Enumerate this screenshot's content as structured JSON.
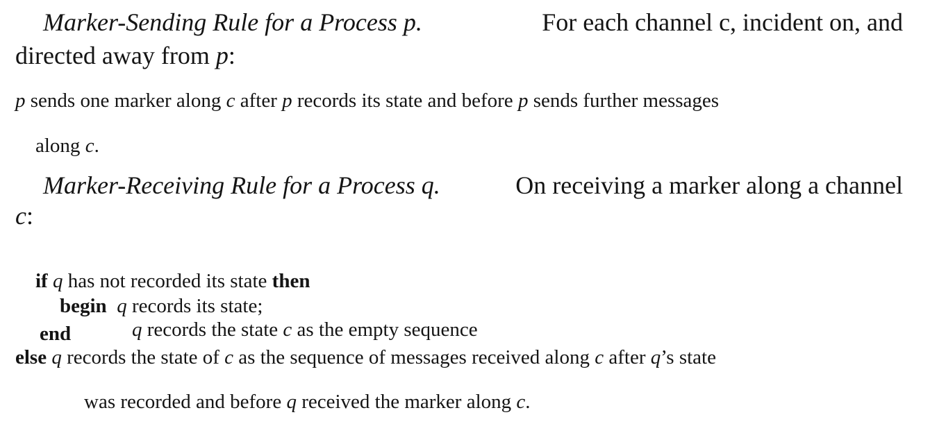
{
  "sending_rule": {
    "title": "Marker-Sending Rule for a Process p.",
    "intro_line1": "For each channel c, incident on, and",
    "intro_line2_a": "directed away from ",
    "intro_line2_p": "p",
    "intro_line2_b": ":",
    "body_line1": {
      "p1": "p",
      "t1": " sends one marker along ",
      "c1": "c",
      "t2": " after ",
      "p2": "p",
      "t3": " records its state and before ",
      "p3": "p",
      "t4": " sends further messages"
    },
    "body_line2": {
      "t1": "along ",
      "c1": "c",
      "t2": "."
    }
  },
  "receiving_rule": {
    "title": "Marker-Receiving Rule for a Process q.",
    "intro_line1": "On receiving a marker along a channel",
    "intro_line2_c": "c",
    "intro_line2_b": ":"
  },
  "algorithm": {
    "if_kw": "if",
    "q1": "q",
    "cond": " has not recorded its state ",
    "then_kw": "then",
    "begin_kw": "begin",
    "q2": "q",
    "stmt1": " records its state;",
    "q3": "q",
    "stmt2a": " records the state ",
    "c1": "c",
    "stmt2b": " as the empty sequence",
    "end_kw": "end",
    "else_kw": "else",
    "q4": "q",
    "else_t1": " records the state of ",
    "c2": "c",
    "else_t2": " as the sequence of messages received along ",
    "c3": "c",
    "else_t3": " after ",
    "q5": "q",
    "else_t4": "’s state",
    "cont_t1": "was recorded and before ",
    "q6": "q",
    "cont_t2": " received the marker along ",
    "c4": "c",
    "cont_t3": "."
  }
}
